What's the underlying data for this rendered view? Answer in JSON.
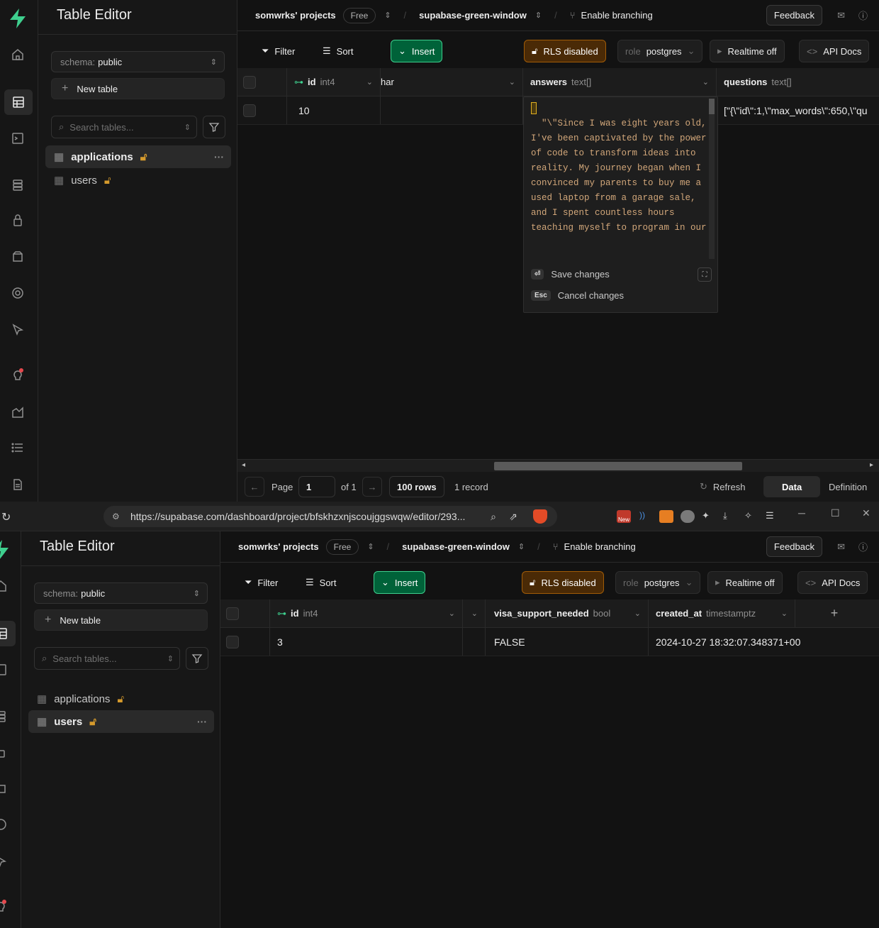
{
  "window1": {
    "sidebar": {
      "title": "Table Editor",
      "schema_label": "schema:",
      "schema_value": "public",
      "new_table": "New table",
      "search_placeholder": "Search tables...",
      "tables": [
        {
          "name": "applications",
          "selected": true
        },
        {
          "name": "users",
          "selected": false
        }
      ]
    },
    "topbar": {
      "org": "somwrks' projects",
      "plan": "Free",
      "project": "supabase-green-window",
      "branching": "Enable branching",
      "feedback": "Feedback"
    },
    "toolbar": {
      "filter": "Filter",
      "sort": "Sort",
      "insert": "Insert",
      "rls": "RLS disabled",
      "role_key": "role",
      "role_value": "postgres",
      "realtime": "Realtime off",
      "api_docs": "API Docs"
    },
    "grid": {
      "columns": [
        {
          "name": "id",
          "type": "int4"
        },
        {
          "name": "har",
          "type": ""
        },
        {
          "name": "answers",
          "type": "text[]"
        },
        {
          "name": "questions",
          "type": "text[]"
        }
      ],
      "row": {
        "id": "10",
        "questions": "[\"{\\\"id\\\":1,\\\"max_words\\\":650,\\\"qu"
      }
    },
    "editor": {
      "text": "\"\\\"Since I was eight years old, I've been captivated by the power of code to transform ideas into reality. My journey began when I convinced my parents to buy me a used laptop from a garage sale, and I spent countless hours teaching myself to program in our",
      "save": "Save changes",
      "cancel": "Cancel changes",
      "esc_key": "Esc"
    },
    "footer": {
      "page_label": "Page",
      "page": "1",
      "of": "of 1",
      "rows": "100 rows",
      "records": "1 record",
      "refresh": "Refresh",
      "data": "Data",
      "definition": "Definition"
    }
  },
  "window2": {
    "url": "https://supabase.com/dashboard/project/bfskhzxnjscoujggswqw/editor/293...",
    "new_badge": "New",
    "sidebar": {
      "title": "Table Editor",
      "schema_label": "schema:",
      "schema_value": "public",
      "new_table": "New table",
      "search_placeholder": "Search tables...",
      "tables": [
        {
          "name": "applications",
          "selected": false
        },
        {
          "name": "users",
          "selected": true
        }
      ]
    },
    "topbar": {
      "org": "somwrks' projects",
      "plan": "Free",
      "project": "supabase-green-window",
      "branching": "Enable branching",
      "feedback": "Feedback"
    },
    "toolbar": {
      "filter": "Filter",
      "sort": "Sort",
      "insert": "Insert",
      "rls": "RLS disabled",
      "role_key": "role",
      "role_value": "postgres",
      "realtime": "Realtime off",
      "api_docs": "API Docs"
    },
    "grid": {
      "columns": [
        {
          "name": "id",
          "type": "int4"
        },
        {
          "name": "visa_support_needed",
          "type": "bool"
        },
        {
          "name": "created_at",
          "type": "timestamptz"
        }
      ],
      "row": {
        "id": "3",
        "visa": "FALSE",
        "created_at": "2024-10-27 18:32:07.348371+00"
      }
    }
  },
  "colors": {
    "accent": "#3ecf8e",
    "insert_bg": "#006239",
    "rls_bg": "#4a2a06",
    "lock": "#d59a2c"
  }
}
